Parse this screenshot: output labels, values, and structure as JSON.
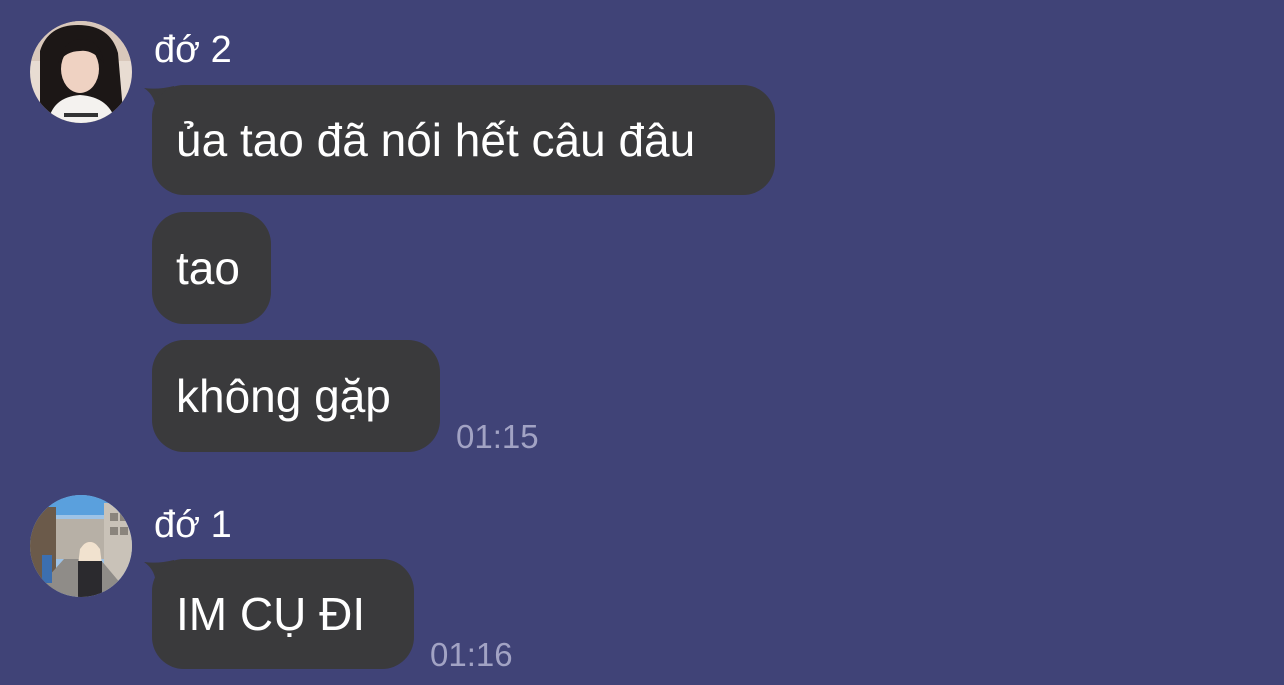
{
  "colors": {
    "background": "#404377",
    "bubble": "#3a3a3c",
    "text": "#ffffff",
    "timestamp": "#a2a3c4"
  },
  "groups": [
    {
      "sender": "đớ 2",
      "avatar_icon": "profile-photo-girl-white-shirt",
      "messages": [
        "ủa tao đã nói hết câu đâu",
        "tao",
        "không gặp"
      ],
      "time": "01:15"
    },
    {
      "sender": "đớ 1",
      "avatar_icon": "profile-photo-street-scene",
      "messages": [
        "IM CỤ ĐI"
      ],
      "time": "01:16"
    }
  ]
}
